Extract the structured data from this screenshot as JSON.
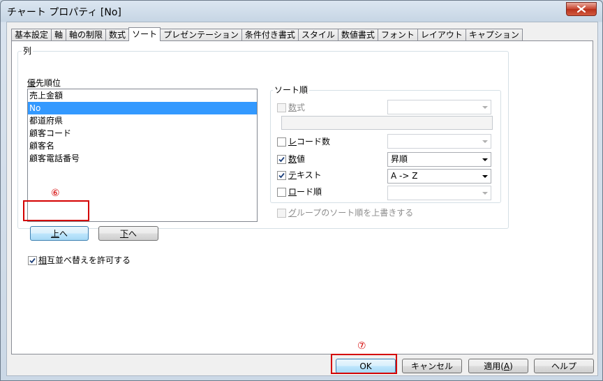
{
  "window": {
    "title": "チャート プロパティ [No]",
    "close_label": "close"
  },
  "tabs": [
    {
      "label": "基本設定",
      "active": false
    },
    {
      "label": "軸",
      "active": false
    },
    {
      "label": "軸の制限",
      "active": false
    },
    {
      "label": "数式",
      "active": false
    },
    {
      "label": "ソート",
      "active": true
    },
    {
      "label": "プレゼンテーション",
      "active": false
    },
    {
      "label": "条件付き書式",
      "active": false
    },
    {
      "label": "スタイル",
      "active": false
    },
    {
      "label": "数値書式",
      "active": false
    },
    {
      "label": "フォント",
      "active": false
    },
    {
      "label": "レイアウト",
      "active": false
    },
    {
      "label": "キャプション",
      "active": false
    }
  ],
  "columns_group": {
    "label": "列",
    "priority_label_key": "優",
    "priority_label_rest": "先順位",
    "items": [
      "売上金額",
      "No",
      "都道府県",
      "顧客コード",
      "顧客名",
      "顧客電話番号"
    ],
    "selected_index": 1,
    "up_button_key": "上",
    "up_button_rest": "へ",
    "down_button_key": "下",
    "down_button_rest": "へ"
  },
  "sort_order": {
    "label": "ソート順",
    "expression": {
      "key": "数",
      "rest": "式",
      "checked": false,
      "disabled": true
    },
    "record_count": {
      "key": "レ",
      "rest": "コード数",
      "checked": false,
      "value": ""
    },
    "numeric": {
      "key": "数",
      "rest": "値",
      "checked": true,
      "value": "昇順"
    },
    "text": {
      "key": "テ",
      "rest": "キスト",
      "checked": true,
      "value": "A -> Z"
    },
    "load_order": {
      "key": "ロ",
      "rest": "ード順",
      "checked": false,
      "value": ""
    },
    "override_group": {
      "key": "グ",
      "rest": "ループのソート順を上書きする",
      "checked": false,
      "disabled": true
    }
  },
  "mutual_sort": {
    "key": "相",
    "rest": "互並べ替えを許可する",
    "checked": true
  },
  "footer": {
    "ok": "OK",
    "cancel": "キャンセル",
    "apply_prefix": "適用(",
    "apply_key": "A",
    "apply_suffix": ")",
    "help": "ヘルプ"
  },
  "annotations": {
    "step6": "⑥",
    "step7": "⑦",
    "color": "#d40000"
  },
  "colors": {
    "selection": "#3399ff",
    "annotation_red": "#d40000"
  }
}
